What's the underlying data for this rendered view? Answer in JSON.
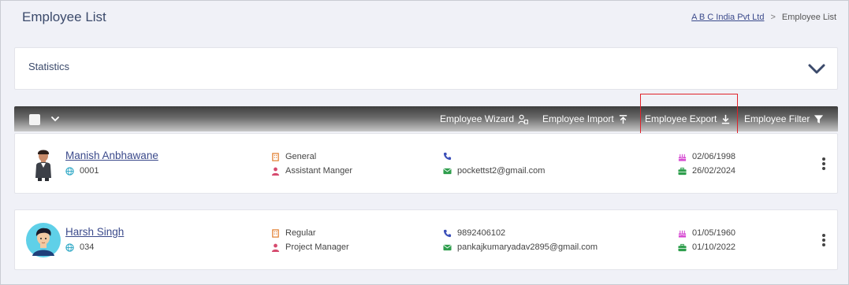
{
  "header": {
    "title": "Employee List",
    "breadcrumb": {
      "company": "A B C India Pvt Ltd",
      "separator": ">",
      "current": "Employee List"
    }
  },
  "statistics": {
    "label": "Statistics",
    "icon": "chevron-down-icon"
  },
  "toolbar": {
    "wizard": "Employee Wizard",
    "import": "Employee Import",
    "export": "Employee Export",
    "filter": "Employee Filter"
  },
  "employees": [
    {
      "name": "Manish Anbhawane",
      "code": "0001",
      "category": "General",
      "designation": "Assistant Manger",
      "phone": "",
      "email": "pockettst2@gmail.com",
      "dob": "02/06/1998",
      "doj": "26/02/2024"
    },
    {
      "name": "Harsh Singh",
      "code": "034",
      "category": "Regular",
      "designation": "Project Manager",
      "phone": "9892406102",
      "email": "pankajkumaryadav2895@gmail.com",
      "dob": "01/05/1960",
      "doj": "01/10/2022"
    }
  ],
  "colors": {
    "accent": "#3b4a8b",
    "globe": "#2aa6c4",
    "category": "#e07b2a",
    "designation": "#d64a6e",
    "phone": "#3b4fb8",
    "email": "#2f9e4d",
    "cake": "#d64ad2",
    "briefcase": "#2f9e4d",
    "highlight": "#e0222a"
  }
}
